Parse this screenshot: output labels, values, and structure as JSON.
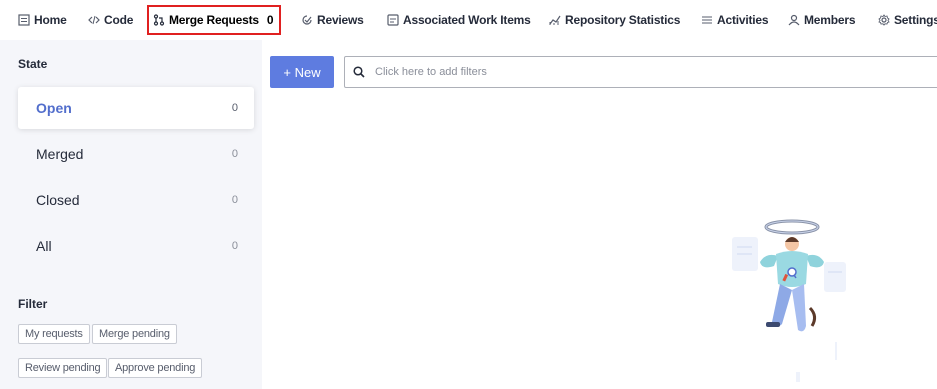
{
  "nav": {
    "items": [
      {
        "label": "Home",
        "icon": "file-icon"
      },
      {
        "label": "Code",
        "icon": "code-icon"
      },
      {
        "label": "Merge Requests",
        "icon": "merge-request-icon",
        "count": "0",
        "active": true
      },
      {
        "label": "Reviews",
        "icon": "review-icon"
      },
      {
        "label": "Associated Work Items",
        "icon": "work-item-icon"
      },
      {
        "label": "Repository Statistics",
        "icon": "statistics-icon"
      },
      {
        "label": "Activities",
        "icon": "list-icon"
      },
      {
        "label": "Members",
        "icon": "members-icon"
      },
      {
        "label": "Settings",
        "icon": "gear-icon"
      }
    ]
  },
  "state": {
    "title": "State",
    "items": [
      {
        "label": "Open",
        "count": "0"
      },
      {
        "label": "Merged",
        "count": "0"
      },
      {
        "label": "Closed",
        "count": "0"
      },
      {
        "label": "All",
        "count": "0"
      }
    ]
  },
  "filter": {
    "title": "Filter",
    "tags": [
      "My requests",
      "Merge pending",
      "Review pending",
      "Approve pending"
    ]
  },
  "toolbar": {
    "new_label": "+ New",
    "filter_placeholder": "Click here to add filters"
  },
  "colors": {
    "accent": "#5e7ce0",
    "active_border": "#e02020",
    "selected_text": "#526ecc"
  }
}
